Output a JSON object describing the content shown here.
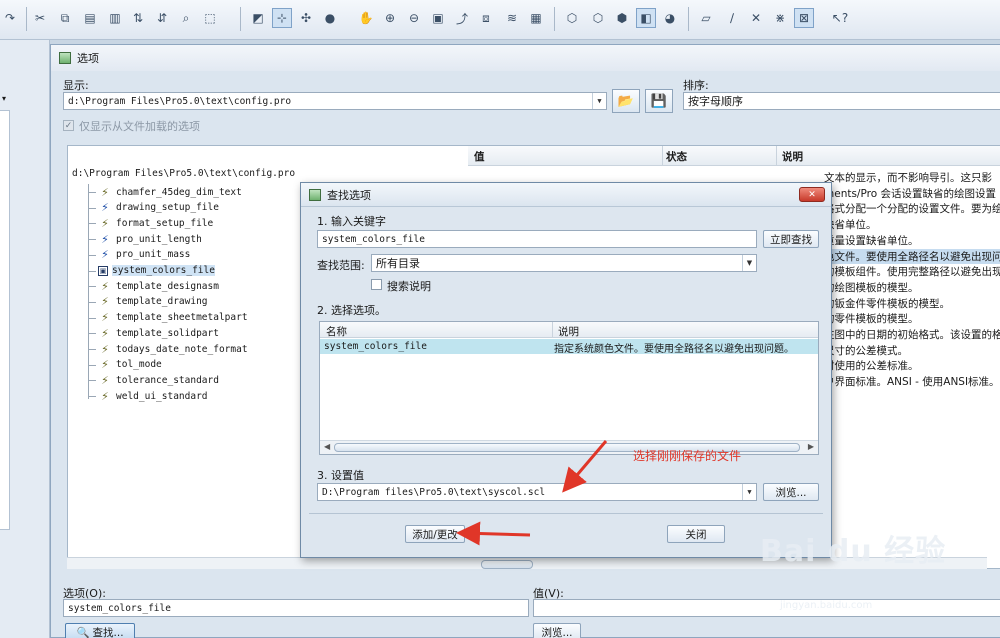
{
  "options_window": {
    "title": "选项",
    "show_label": "显示:",
    "show_path": "d:\\Program Files\\Pro5.0\\text\\config.pro",
    "sort_label": "排序:",
    "sort_value": "按字母顺序",
    "only_from_file_label": "仅显示从文件加载的选项",
    "columns": {
      "value": "值",
      "status": "状态",
      "description": "说明"
    },
    "tree_root": "d:\\Program Files\\Pro5.0\\text\\config.pro",
    "tree_items": [
      {
        "name": "chamfer_45deg_dim_text",
        "icon": "lightning-icon"
      },
      {
        "name": "drawing_setup_file",
        "icon": "lightning-blue-icon"
      },
      {
        "name": "format_setup_file",
        "icon": "lightning-icon"
      },
      {
        "name": "pro_unit_length",
        "icon": "lightning-blue-icon"
      },
      {
        "name": "pro_unit_mass",
        "icon": "lightning-blue-icon"
      },
      {
        "name": "system_colors_file",
        "icon": "box-icon"
      },
      {
        "name": "template_designasm",
        "icon": "lightning-icon"
      },
      {
        "name": "template_drawing",
        "icon": "lightning-icon"
      },
      {
        "name": "template_sheetmetalpart",
        "icon": "lightning-icon"
      },
      {
        "name": "template_solidpart",
        "icon": "lightning-icon"
      },
      {
        "name": "todays_date_note_format",
        "icon": "lightning-icon"
      },
      {
        "name": "tol_mode",
        "icon": "lightning-icon"
      },
      {
        "name": "tolerance_standard",
        "icon": "lightning-icon"
      },
      {
        "name": "weld_ui_standard",
        "icon": "lightning-icon"
      }
    ],
    "descriptions": [
      "文本的显示，而不影响导引。这只影",
      "ments/Pro 会话设置缺省的绘图设置",
      "格式分配一个分配的设置文件。要为绘",
      "缺省单位。",
      "重量设置缺省单位。",
      "色文件。要使用全路径名以避免出现问",
      "的模板组件。使用完整路径以避免出现",
      "的绘图模板的模型。",
      "的钣金件零件模板的模型。",
      "的零件模板的模型。",
      "注图中的日期的初始格式。该设置的格",
      "尺寸的公差模式。",
      "时使用的公差标准。",
      "户界面标准。ANSI - 使用ANSI标准。"
    ],
    "option_label": "选项(O):",
    "option_value": "system_colors_file",
    "value_label": "值(V):",
    "find_button": "查找...",
    "browse_button": "浏览..."
  },
  "find_dialog": {
    "title": "查找选项",
    "step1": "1.  输入关键字",
    "keyword": "system_colors_file",
    "search_now": "立即查找",
    "scope_label": "查找范围:",
    "scope_value": "所有目录",
    "search_desc": "搜索说明",
    "step2": "2.  选择选项。",
    "list_columns": {
      "name": "名称",
      "description": "说明"
    },
    "list_row": {
      "name": "system_colors_file",
      "description": "指定系统颜色文件。要使用全路径名以避免出现问题。"
    },
    "step3": "3.  设置值",
    "set_value": "D:\\Program files\\Pro5.0\\text\\syscol.scl",
    "browse": "浏览...",
    "add_change": "添加/更改",
    "close": "关闭"
  },
  "annotation": "选择刚刚保存的文件",
  "watermark": {
    "logo": "Bai du 经验",
    "url": "jingyan.baidu.com"
  },
  "colors": {
    "annotation": "#e03628",
    "selection": "#bfe4ef",
    "close_button": "#c7392a"
  }
}
